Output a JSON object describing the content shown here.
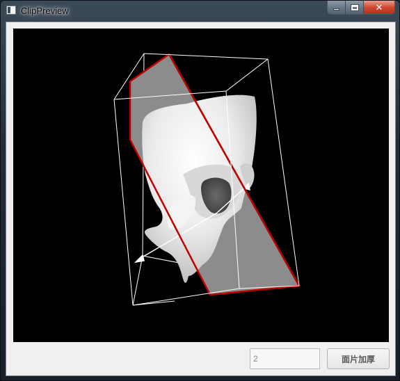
{
  "window": {
    "title": "ClipPreview",
    "icon": "window-icon",
    "buttons": {
      "minimize": "minimize-icon",
      "maximize": "maximize-icon",
      "close": "✕"
    }
  },
  "viewport": {
    "content": "3d-skull-model-with-clip-plane",
    "background_color": "#000000",
    "clip_plane_edge_color": "#c00000",
    "clip_plane_fill_color": "#8c8c8c",
    "bounding_box_color": "#ffffff"
  },
  "controls": {
    "thickness_value": "2",
    "thicken_button_label": "面片加厚"
  }
}
